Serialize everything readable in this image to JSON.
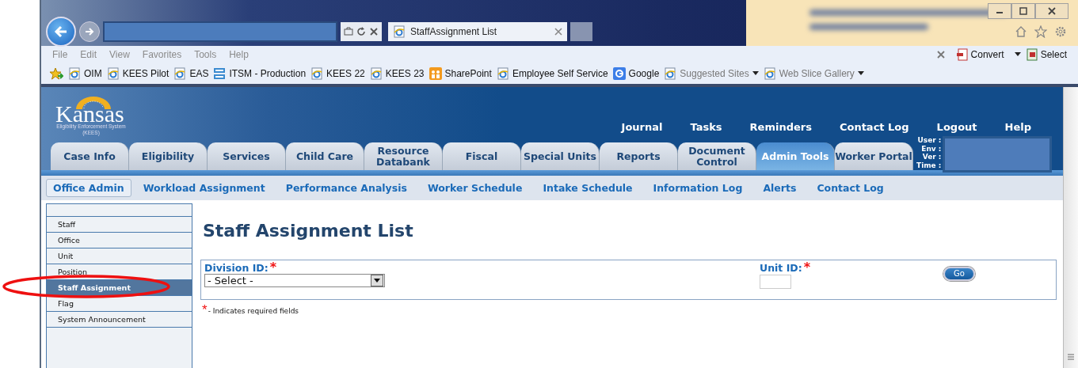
{
  "browser": {
    "tab": {
      "title": "StaffAssignment List",
      "selected": true
    },
    "menu": [
      "File",
      "Edit",
      "View",
      "Favorites",
      "Tools",
      "Help"
    ],
    "command_bar": [
      {
        "label": "Convert",
        "kind": "convert",
        "dropdown": true
      },
      {
        "label": "Select",
        "kind": "select",
        "dropdown": false
      }
    ],
    "favorites": [
      {
        "label": "OIM",
        "kind": "ie",
        "dropdown": false,
        "dimmed": false
      },
      {
        "label": "KEES Pilot",
        "kind": "ie",
        "dropdown": false,
        "dimmed": false
      },
      {
        "label": "EAS",
        "kind": "ie",
        "dropdown": false,
        "dimmed": false
      },
      {
        "label": "ITSM - Production",
        "kind": "itsm",
        "dropdown": false,
        "dimmed": false
      },
      {
        "label": "KEES 22",
        "kind": "ie",
        "dropdown": false,
        "dimmed": false
      },
      {
        "label": "KEES 23",
        "kind": "ie",
        "dropdown": false,
        "dimmed": false
      },
      {
        "label": "SharePoint",
        "kind": "sharepoint",
        "dropdown": false,
        "dimmed": false
      },
      {
        "label": "Employee Self Service",
        "kind": "ie",
        "dropdown": false,
        "dimmed": false
      },
      {
        "label": "Google",
        "kind": "google",
        "dropdown": false,
        "dimmed": false
      },
      {
        "label": "Suggested Sites",
        "kind": "ie",
        "dropdown": true,
        "dimmed": true
      },
      {
        "label": "Web Slice Gallery",
        "kind": "ie",
        "dropdown": true,
        "dimmed": true
      }
    ]
  },
  "app": {
    "logo": {
      "title": "Kansas",
      "subtitle": "Eligibility Enforcement System (KEES)"
    },
    "top_links": [
      "Journal",
      "Tasks",
      "Reminders",
      "Contact Log",
      "Logout",
      "Help"
    ],
    "tabs": [
      {
        "label": "Case Info",
        "selected": false
      },
      {
        "label": "Eligibility",
        "selected": false
      },
      {
        "label": "Services",
        "selected": false
      },
      {
        "label": "Child Care",
        "selected": false
      },
      {
        "label": "Resource Databank",
        "selected": false
      },
      {
        "label": "Fiscal",
        "selected": false
      },
      {
        "label": "Special Units",
        "selected": false
      },
      {
        "label": "Reports",
        "selected": false
      },
      {
        "label": "Document Control",
        "selected": false
      },
      {
        "label": "Admin Tools",
        "selected": true
      },
      {
        "label": "Worker Portal",
        "selected": false
      }
    ],
    "user_info_labels": [
      "User :",
      "Env :",
      "Ver :",
      "Time :"
    ],
    "subnav": [
      {
        "label": "Office Admin",
        "selected": true
      },
      {
        "label": "Workload Assignment",
        "selected": false
      },
      {
        "label": "Performance Analysis",
        "selected": false
      },
      {
        "label": "Worker Schedule",
        "selected": false
      },
      {
        "label": "Intake Schedule",
        "selected": false
      },
      {
        "label": "Information Log",
        "selected": false
      },
      {
        "label": "Alerts",
        "selected": false
      },
      {
        "label": "Contact Log",
        "selected": false
      }
    ],
    "sidebar": [
      {
        "label": "Staff",
        "selected": false
      },
      {
        "label": "Office",
        "selected": false
      },
      {
        "label": "Unit",
        "selected": false
      },
      {
        "label": "Position",
        "selected": false
      },
      {
        "label": "Staff Assignment",
        "selected": true
      },
      {
        "label": "Flag",
        "selected": false
      },
      {
        "label": "System Announcement",
        "selected": false
      }
    ],
    "page_title": "Staff Assignment List",
    "form": {
      "division": {
        "label": "Division ID:",
        "required_mark": "*",
        "value": "- Select -"
      },
      "unit": {
        "label": "Unit ID:",
        "required_mark": "*"
      },
      "go_button": "Go",
      "required_note": {
        "mark": "*",
        "text": "- Indicates required fields"
      }
    }
  }
}
